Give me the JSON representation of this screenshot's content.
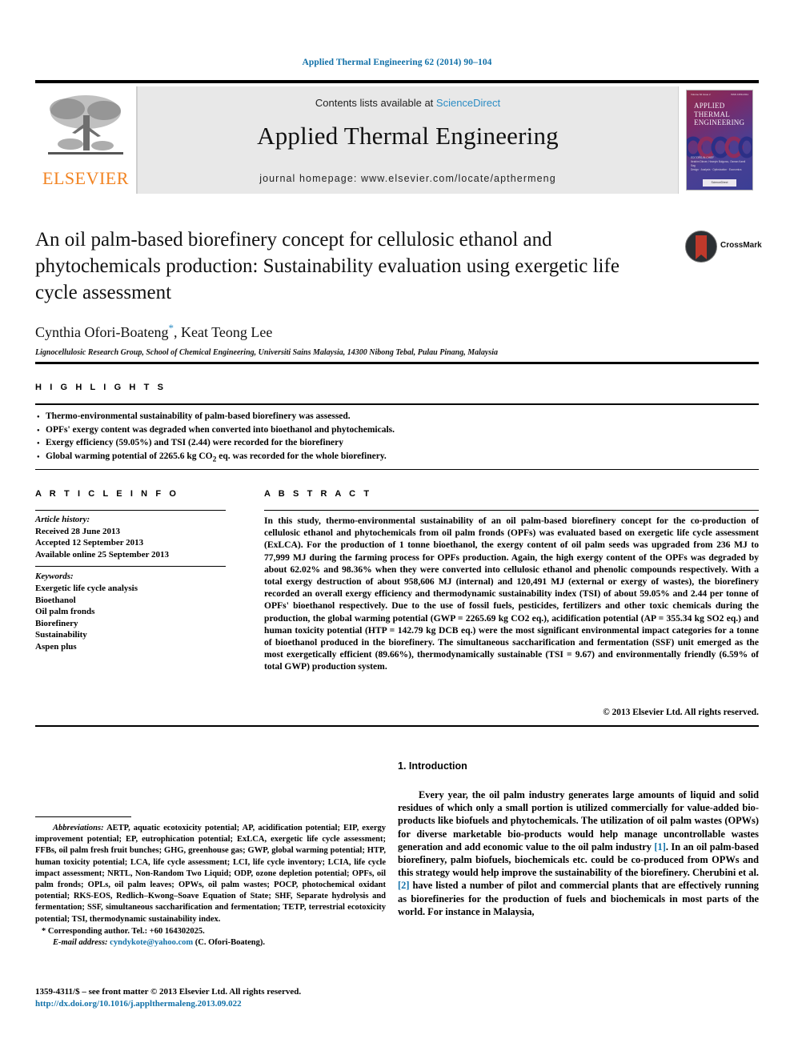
{
  "running_head": "Applied Thermal Engineering 62 (2014) 90–104",
  "masthead": {
    "publisher_name": "ELSEVIER",
    "contents_prefix": "Contents lists available at ",
    "contents_link": "ScienceDirect",
    "journal_title": "Applied Thermal Engineering",
    "homepage": "journal homepage: www.elsevier.com/locate/apthermeng",
    "cover": {
      "line1": "APPLIED",
      "line2": "THERMAL",
      "line3": "ENGINEERING",
      "top_left": "Volume 62 Issue 2",
      "top_right": "ISSN 1359-4311",
      "foot1": "EDITORS-IN-CHIEF",
      "foot2": "Ibrahim Dincer, Hoseyin Bulgurcu, Osman Kamil Sag",
      "foot3": "Design · Analysis · Optimization · Economics",
      "badge": "ScienceDirect"
    }
  },
  "article": {
    "title": "An oil palm-based biorefinery concept for cellulosic ethanol and phytochemicals production: Sustainability evaluation using exergetic life cycle assessment",
    "authors": "Cynthia Ofori-Boateng",
    "authors_rest": ", Keat Teong Lee",
    "corresponding_marker": "*",
    "affiliation": "Lignocellulosic Research Group, School of Chemical Engineering, Universiti Sains Malaysia, 14300 Nibong Tebal, Pulau Pinang, Malaysia",
    "crossmark_label": "CrossMark"
  },
  "highlights": {
    "heading": "H I G H L I G H T S",
    "items": [
      "Thermo-environmental sustainability of palm-based biorefinery was assessed.",
      "OPFs' exergy content was degraded when converted into bioethanol and phytochemicals.",
      "Exergy efficiency (59.05%) and TSI (2.44) were recorded for the biorefinery",
      "Global warming potential of 2265.6 kg CO2 eq. was recorded for the whole biorefinery."
    ]
  },
  "article_info": {
    "heading": "A R T I C L E   I N F O",
    "history_label": "Article history:",
    "history": [
      "Received 28 June 2013",
      "Accepted 12 September 2013",
      "Available online 25 September 2013"
    ],
    "keywords_label": "Keywords:",
    "keywords": [
      "Exergetic life cycle analysis",
      "Bioethanol",
      "Oil palm fronds",
      "Biorefinery",
      "Sustainability",
      "Aspen plus"
    ]
  },
  "abstract": {
    "heading": "A B S T R A C T",
    "text": "In this study, thermo-environmental sustainability of an oil palm-based biorefinery concept for the co-production of cellulosic ethanol and phytochemicals from oil palm fronds (OPFs) was evaluated based on exergetic life cycle assessment (ExLCA). For the production of 1 tonne bioethanol, the exergy content of oil palm seeds was upgraded from 236 MJ to 77,999 MJ during the farming process for OPFs production. Again, the high exergy content of the OPFs was degraded by about 62.02% and 98.36% when they were converted into cellulosic ethanol and phenolic compounds respectively. With a total exergy destruction of about 958,606 MJ (internal) and 120,491 MJ (external or exergy of wastes), the biorefinery recorded an overall exergy efficiency and thermodynamic sustainability index (TSI) of about 59.05% and 2.44 per tonne of OPFs' bioethanol respectively. Due to the use of fossil fuels, pesticides, fertilizers and other toxic chemicals during the production, the global warming potential (GWP = 2265.69 kg CO2 eq.), acidification potential (AP = 355.34 kg SO2 eq.) and human toxicity potential (HTP = 142.79 kg DCB eq.) were the most significant environmental impact categories for a tonne of bioethanol produced in the biorefinery. The simultaneous saccharification and fermentation (SSF) unit emerged as the most exergetically efficient (89.66%), thermodynamically sustainable (TSI = 9.67) and environmentally friendly (6.59% of total GWP) production system.",
    "copyright": "© 2013 Elsevier Ltd. All rights reserved."
  },
  "introduction": {
    "heading": "1.  Introduction",
    "para1_a": "Every year, the oil palm industry generates large amounts of liquid and solid residues of which only a small portion is utilized commercially for value-added bio-products like biofuels and phytochemicals. The utilization of oil palm wastes (OPWs) for diverse marketable bio-products would help manage uncontrollable wastes generation and add economic value to the oil palm industry ",
    "ref1": "[1]",
    "para1_b": ". In an oil palm-based biorefinery, palm biofuels, biochemicals etc. could be co-produced from OPWs and this strategy would help improve the sustainability of the biorefinery. Cherubini et al. ",
    "ref2": "[2]",
    "para1_c": " have listed a number of pilot and commercial plants that are effectively running as biorefineries for the production of fuels and biochemicals in most parts of the world. For instance in Malaysia,"
  },
  "footnotes": {
    "abbreviations_label": "Abbreviations:",
    "abbreviations_text": " AETP, aquatic ecotoxicity potential; AP, acidification potential; EIP, exergy improvement potential; EP, eutrophication potential; ExLCA, exergetic life cycle assessment; FFBs, oil palm fresh fruit bunches; GHG, greenhouse gas; GWP, global warming potential; HTP, human toxicity potential; LCA, life cycle assessment; LCI, life cycle inventory; LCIA, life cycle impact assessment; NRTL, Non-Random Two Liquid; ODP, ozone depletion potential; OPFs, oil palm fronds; OPLs, oil palm leaves; OPWs, oil palm wastes; POCP, photochemical oxidant potential; RKS-EOS, Redlich–Kwong–Soave Equation of State; SHF, Separate hydrolysis and fermentation; SSF, simultaneous saccharification and fermentation; TETP, terrestrial ecotoxicity potential; TSI, thermodynamic sustainability index.",
    "corresponding": "* Corresponding author. Tel.: +60 164302025.",
    "email_label": "E-mail address:",
    "email": "cyndykote@yahoo.com",
    "email_suffix": " (C. Ofori-Boateng)."
  },
  "imprint": {
    "line1": "1359-4311/$ – see front matter © 2013 Elsevier Ltd. All rights reserved.",
    "doi": "http://dx.doi.org/10.1016/j.applthermaleng.2013.09.022"
  },
  "colors": {
    "link": "#1070a8",
    "sciencedirect": "#2b8cc4",
    "elsevier_orange": "#f28321",
    "band_gray": "#e8e8e8"
  }
}
